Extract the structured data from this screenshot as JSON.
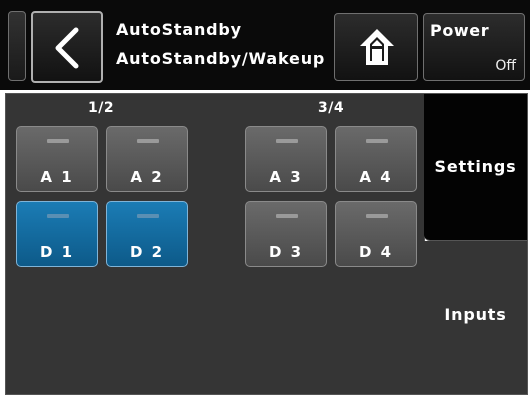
{
  "header": {
    "title_line1": "AutoStandby",
    "title_line2": "AutoStandby/Wakeup",
    "power": {
      "label": "Power",
      "state": "Off"
    }
  },
  "groups": [
    {
      "label": "1/2"
    },
    {
      "label": "3/4"
    }
  ],
  "channels": {
    "A1": {
      "label": "A 1",
      "active": false
    },
    "A2": {
      "label": "A 2",
      "active": false
    },
    "D1": {
      "label": "D 1",
      "active": true
    },
    "D2": {
      "label": "D 2",
      "active": true
    },
    "A3": {
      "label": "A 3",
      "active": false
    },
    "A4": {
      "label": "A 4",
      "active": false
    },
    "D3": {
      "label": "D 3",
      "active": false
    },
    "D4": {
      "label": "D 4",
      "active": false
    }
  },
  "tabs": {
    "settings": {
      "label": "Settings",
      "selected": false
    },
    "inputs": {
      "label": "Inputs",
      "selected": true
    }
  },
  "colors": {
    "active_channel": "#1b7cb5",
    "inactive_channel": "#5a5a5a",
    "panel_background": "#353535",
    "header_background": "#0a0a0a"
  },
  "icons": {
    "back": "chevron-left-icon",
    "home": "home-icon"
  }
}
